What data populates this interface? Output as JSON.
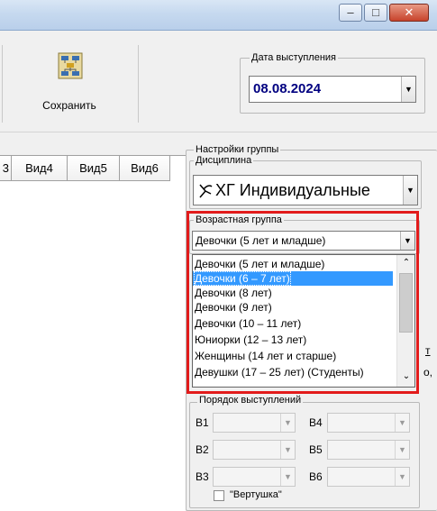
{
  "window": {
    "minimize_glyph": "‒",
    "maximize_glyph": "□",
    "close_glyph": "✕"
  },
  "toolbar": {
    "save_label": "Сохранить"
  },
  "performance_date": {
    "label": "Дата выступления",
    "value": "08.08.2024"
  },
  "grid": {
    "columns": [
      "3",
      "Вид4",
      "Вид5",
      "Вид6"
    ]
  },
  "group_settings": {
    "title": "Настройки группы",
    "discipline": {
      "label": "Дисциплина",
      "icon": "gymnast-ribbon-icon",
      "value": "ХГ Индивидуальные"
    },
    "age_group": {
      "label": "Возрастная группа",
      "selected": "Девочки (5 лет и младше)",
      "options": [
        "Девочки (5 лет и младше)",
        "Девочки (6 – 7 лет)",
        "Девочки (8 лет)",
        "Девочки (9 лет)",
        "Девочки (10 – 11 лет)",
        "Юниорки (12 – 13 лет)",
        "Женщины (14 лет и старше)",
        "Девушки (17 – 25 лет) (Студенты)"
      ],
      "highlighted_index": 1
    },
    "order": {
      "label": "Порядок выступлений",
      "slots": [
        "В1",
        "В4",
        "В2",
        "В5",
        "В3",
        "В6"
      ],
      "spin_label": "\"Вертушка\"",
      "spin_checked": false
    },
    "edge_fragment_1": "т",
    "edge_fragment_2": "о,"
  },
  "colors": {
    "highlight": "#e21b1b",
    "selection": "#3399ff",
    "date_text": "#000080"
  }
}
